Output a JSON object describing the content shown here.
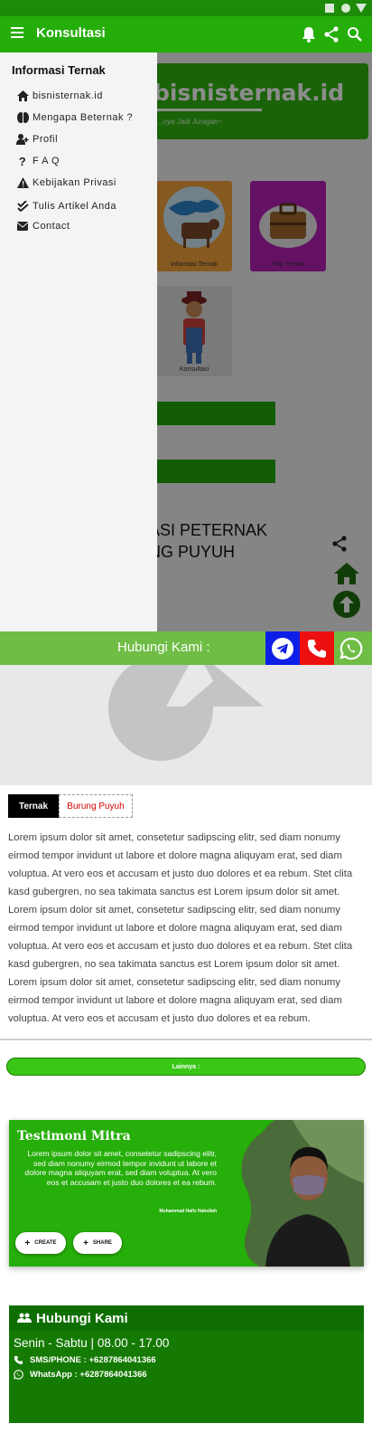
{
  "appbar": {
    "title": "Konsultasi"
  },
  "page": {
    "banner_title": "bisnisternak.id",
    "banner_subtitle": "...nya Jadi Juragan~",
    "tiles": [
      {
        "label": "Informasi Ternak"
      },
      {
        "label": "Titip Ternak"
      },
      {
        "label": "Konsultasi"
      }
    ],
    "headline_lines": [
      "ASI PETERNAK",
      "NG PUYUH"
    ]
  },
  "drawer": {
    "heading": "Informasi Ternak",
    "items": [
      {
        "label": "bisnisternak.id",
        "icon": "home-icon"
      },
      {
        "label": "Mengapa Beternak ?",
        "icon": "brain-icon"
      },
      {
        "label": "Profil",
        "icon": "user-plus-icon"
      },
      {
        "label": "F A Q",
        "icon": "question-icon"
      },
      {
        "label": "Kebijakan Privasi",
        "icon": "warning-icon"
      },
      {
        "label": "Tulis Artikel Anda",
        "icon": "double-check-icon"
      },
      {
        "label": "Contact",
        "icon": "envelope-icon"
      }
    ]
  },
  "contact_bar": {
    "label": "Hubungi Kami :"
  },
  "article": {
    "tags": [
      "Ternak",
      "Burung Puyuh"
    ],
    "body": "Lorem ipsum dolor sit amet, consetetur sadipscing elitr, sed diam nonumy eirmod tempor invidunt ut labore et dolore magna aliquyam erat, sed diam voluptua. At vero eos et accusam et justo duo dolores et ea rebum. Stet clita kasd gubergren, no sea takimata sanctus est Lorem ipsum dolor sit amet. Lorem ipsum dolor sit amet, consetetur sadipscing elitr, sed diam nonumy eirmod tempor invidunt ut labore et dolore magna aliquyam erat, sed diam voluptua. At vero eos et accusam et justo duo dolores et ea rebum. Stet clita kasd gubergren, no sea takimata sanctus est Lorem ipsum dolor sit amet. Lorem ipsum dolor sit amet, consetetur sadipscing elitr, sed diam nonumy eirmod tempor invidunt ut labore et dolore magna aliquyam erat, sed diam voluptua. At vero eos et accusam et justo duo dolores et ea rebum.",
    "more_label": "Lainnya :"
  },
  "testimoni": {
    "title": "Testimoni Mitra",
    "body": "Lorem ipsum dolor sit amet, consetetur sadipscing elitr, sed diam nonumy eirmod tempor invidunt ut labore et dolore magna aliquyam erat, sed diam voluptua. At vero eos et accusam et justo duo dolores et ea rebum.",
    "author": "Muhammad Hafiz Habullah",
    "create_label": "CREATE",
    "share_label": "SHARE"
  },
  "hubungi": {
    "title": "Hubungi Kami",
    "hours": "Senin - Sabtu | 08.00 - 17.00",
    "phone": "SMS/PHONE : +6287864041366",
    "whatsapp": "WhatsApp : +6287864041366"
  },
  "colors": {
    "primary": "#25ae0a",
    "status_bar": "#1d8a08",
    "telegram": "#0d1ee6",
    "phone": "#ee1010",
    "contact_bar": "#6fbd45"
  }
}
